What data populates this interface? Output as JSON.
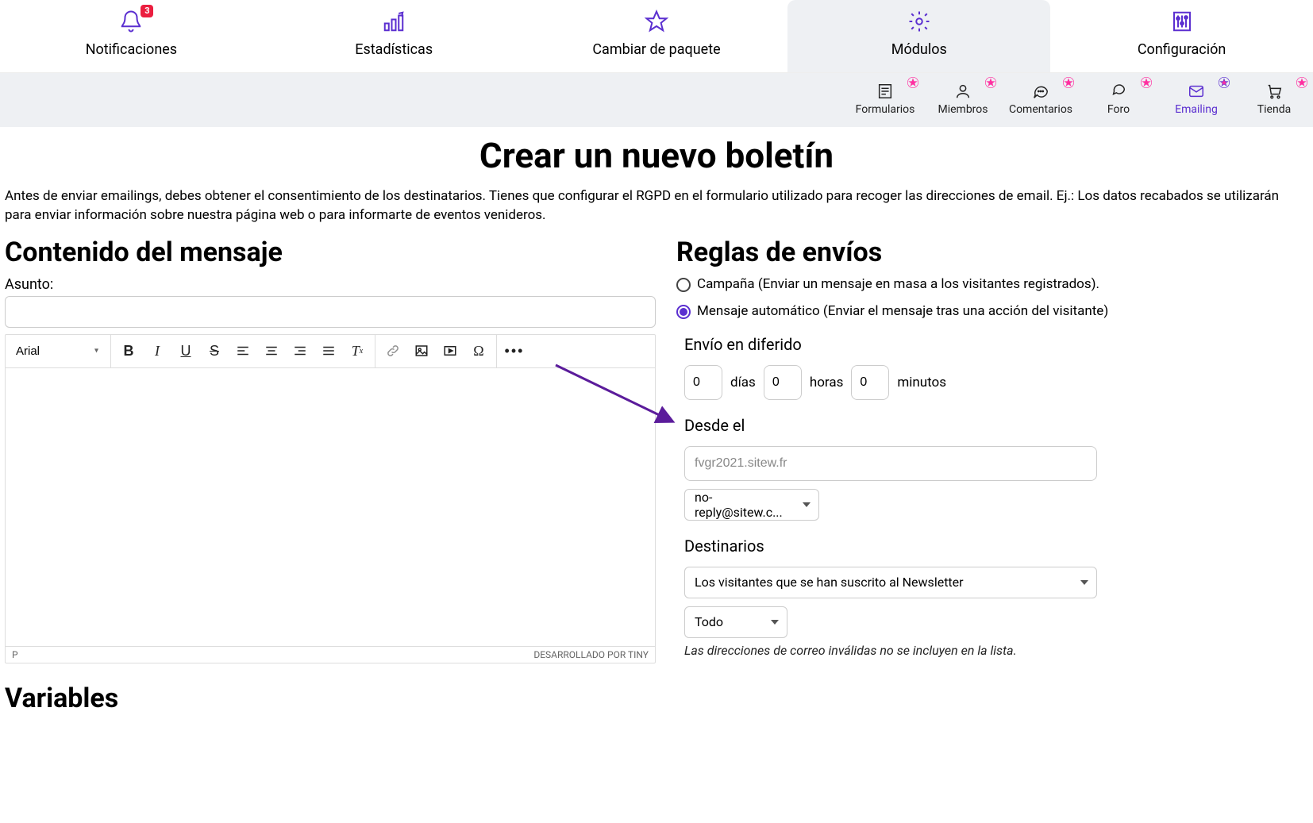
{
  "top_tabs": {
    "notifications": {
      "label": "Notificaciones",
      "badge": "3"
    },
    "statistics": {
      "label": "Estadísticas"
    },
    "change_plan": {
      "label": "Cambiar de paquete"
    },
    "modules": {
      "label": "Módulos"
    },
    "settings": {
      "label": "Configuración"
    }
  },
  "sub_tabs": {
    "forms": "Formularios",
    "members": "Miembros",
    "comments": "Comentarios",
    "forum": "Foro",
    "emailing": "Emailing",
    "shop": "Tienda"
  },
  "page_title": "Crear un nuevo boletín",
  "intro_text": "Antes de enviar emailings, debes obtener el consentimiento de los destinatarios. Tienes que configurar el RGPD en el formulario utilizado para recoger las direcciones de email. Ej.: Los datos recabados se utilizarán para enviar información sobre nuestra página web o para informarte de eventos venideros.",
  "left": {
    "section_title": "Contenido del mensaje",
    "subject_label": "Asunto:",
    "subject_value": "",
    "font_name": "Arial",
    "status_path": "P",
    "powered_by": "DESARROLLADO POR TINY",
    "variables_title": "Variables"
  },
  "right": {
    "section_title": "Reglas de envíos",
    "option_campaign": "Campaña (Enviar un mensaje en masa a los visitantes registrados).",
    "option_auto": "Mensaje automático (Enviar el mensaje tras una acción del visitante)",
    "delayed_heading": "Envío en diferido",
    "delay": {
      "days": "0",
      "days_label": "días",
      "hours": "0",
      "hours_label": "horas",
      "minutes": "0",
      "minutes_label": "minutos"
    },
    "from_heading": "Desde el",
    "from_domain": "fvgr2021.sitew.fr",
    "from_email": "no-reply@sitew.c...",
    "recipients_heading": "Destinarios",
    "recipients_select": "Los visitantes que se han suscrito al Newsletter",
    "recipients_filter": "Todo",
    "recipients_hint": "Las direcciones de correo inválidas no se incluyen en la lista."
  }
}
